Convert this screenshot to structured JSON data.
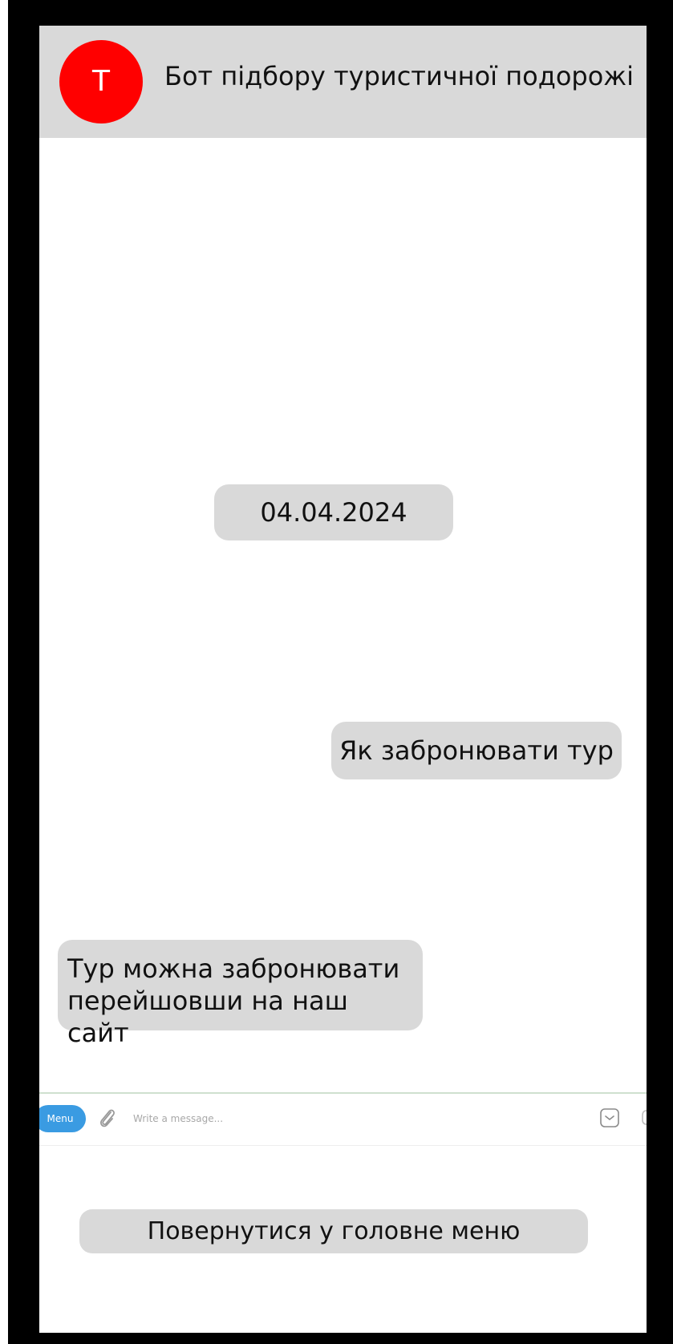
{
  "colors": {
    "frame": "#000000",
    "header_background": "#d9d9d9",
    "avatar_background": "#ff0000",
    "bubble_background": "#d9d9d9",
    "menu_button": "#3a9be2"
  },
  "header": {
    "avatar_letter": "T",
    "title": "Бот підбору туристичної подорожі"
  },
  "chat": {
    "date": "04.04.2024",
    "outgoing_message": "Як забронювати тур",
    "incoming_message_line1": "Тур можна забронювати",
    "incoming_message_line2": "перейшовши на наш сайт"
  },
  "composer": {
    "menu_label": "Menu",
    "placeholder": "Write a message...",
    "attach_icon": "paperclip-icon",
    "emoji_icon": "sticker-icon",
    "mic_icon": "microphone-icon"
  },
  "keyboard": {
    "main_menu_label": "Повернутися у головне меню"
  }
}
